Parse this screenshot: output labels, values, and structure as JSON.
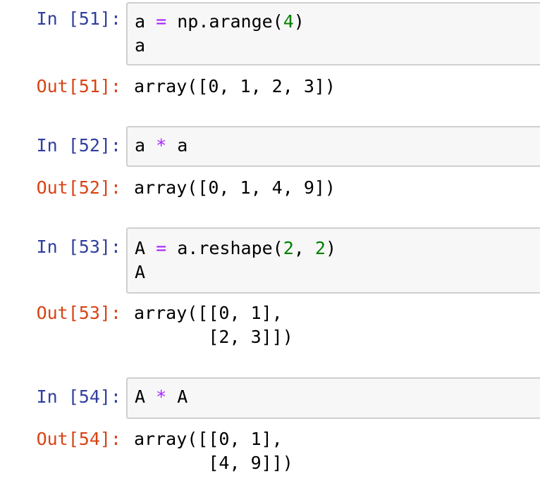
{
  "cells": [
    {
      "in_prompt": "In [51]:",
      "out_prompt": "Out[51]:",
      "code": [
        [
          "a",
          " = ",
          "np.arange(",
          "4",
          ")"
        ],
        [
          "a"
        ]
      ],
      "output": [
        "array([0, 1, 2, 3])"
      ]
    },
    {
      "in_prompt": "In [52]:",
      "out_prompt": "Out[52]:",
      "code": [
        [
          "a",
          " * ",
          "a"
        ]
      ],
      "output": [
        "array([0, 1, 4, 9])"
      ]
    },
    {
      "in_prompt": "In [53]:",
      "out_prompt": "Out[53]:",
      "code": [
        [
          "A",
          " = ",
          "a.reshape(",
          "2",
          ", ",
          "2",
          ")"
        ],
        [
          "A"
        ]
      ],
      "output": [
        "array([[0, 1],",
        "       [2, 3]])"
      ]
    },
    {
      "in_prompt": "In [54]:",
      "out_prompt": "Out[54]:",
      "code": [
        [
          "A",
          " * ",
          "A"
        ]
      ],
      "output": [
        "array([[0, 1],",
        "       [4, 9]])"
      ]
    }
  ]
}
